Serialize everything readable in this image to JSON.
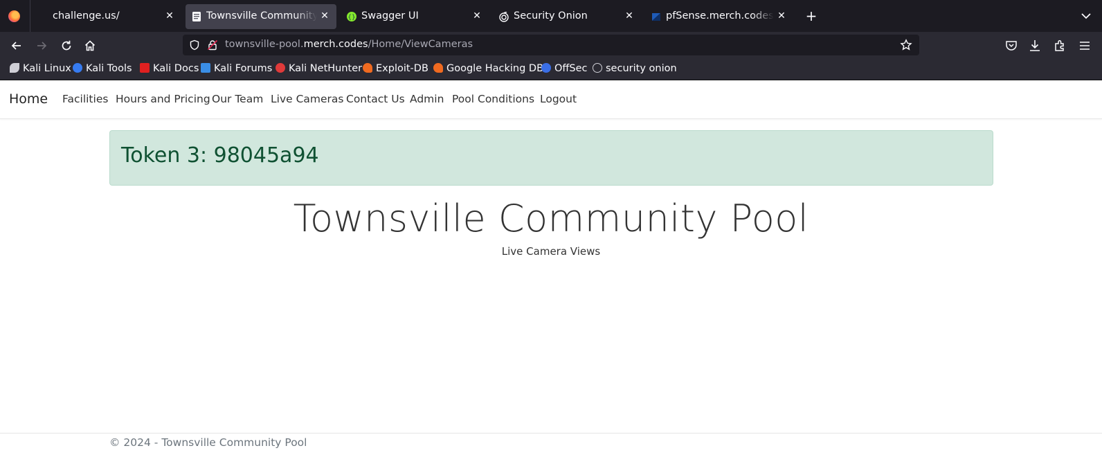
{
  "browser": {
    "tabs": [
      {
        "title": "challenge.us/",
        "icon": "page-icon",
        "active": false
      },
      {
        "title": "Townsville Community Pool",
        "icon": "document-icon",
        "active": true
      },
      {
        "title": "Swagger UI",
        "icon": "swagger-icon",
        "active": false
      },
      {
        "title": "Security Onion",
        "icon": "onion-icon",
        "active": false
      },
      {
        "title": "pfSense.merch.codes - Dashboard",
        "icon": "pfsense-icon",
        "active": false
      }
    ],
    "new_tab_label": "+",
    "url": {
      "prefix": "townsville-pool.",
      "domain": "merch.codes",
      "path": "/Home/ViewCameras"
    },
    "bookmarks": [
      {
        "label": "Kali Linux",
        "icon": "kali-icon",
        "color": "#cfcfd6"
      },
      {
        "label": "Kali Tools",
        "icon": "kali-tools-icon",
        "color": "#367bf0"
      },
      {
        "label": "Kali Docs",
        "icon": "kali-docs-icon",
        "color": "#e02020"
      },
      {
        "label": "Kali Forums",
        "icon": "kali-forums-icon",
        "color": "#3a8ee6"
      },
      {
        "label": "Kali NetHunter",
        "icon": "nethunter-icon",
        "color": "#e03a3a"
      },
      {
        "label": "Exploit-DB",
        "icon": "exploit-db-icon",
        "color": "#f06a20"
      },
      {
        "label": "Google Hacking DB",
        "icon": "ghdb-icon",
        "color": "#f06a20"
      },
      {
        "label": "OffSec",
        "icon": "offsec-icon",
        "color": "#3a6ee6"
      },
      {
        "label": "security onion",
        "icon": "onion-icon",
        "color": "#cfcfd6"
      }
    ]
  },
  "site": {
    "brand": "Home",
    "nav": [
      "Facilities",
      "Hours and Pricing",
      "Our Team",
      "Live Cameras",
      "Contact Us",
      "Admin",
      "Pool Conditions",
      "Logout"
    ],
    "alert": "Token 3: 98045a94",
    "title": "Townsville Community Pool",
    "subtitle": "Live Camera Views",
    "footer": "© 2024 - Townsville Community Pool"
  },
  "colors": {
    "alert_bg": "#d1e7dd",
    "alert_text": "#0f5132",
    "chrome_dark": "#1c1b22",
    "chrome_toolbar": "#2b2a33"
  }
}
